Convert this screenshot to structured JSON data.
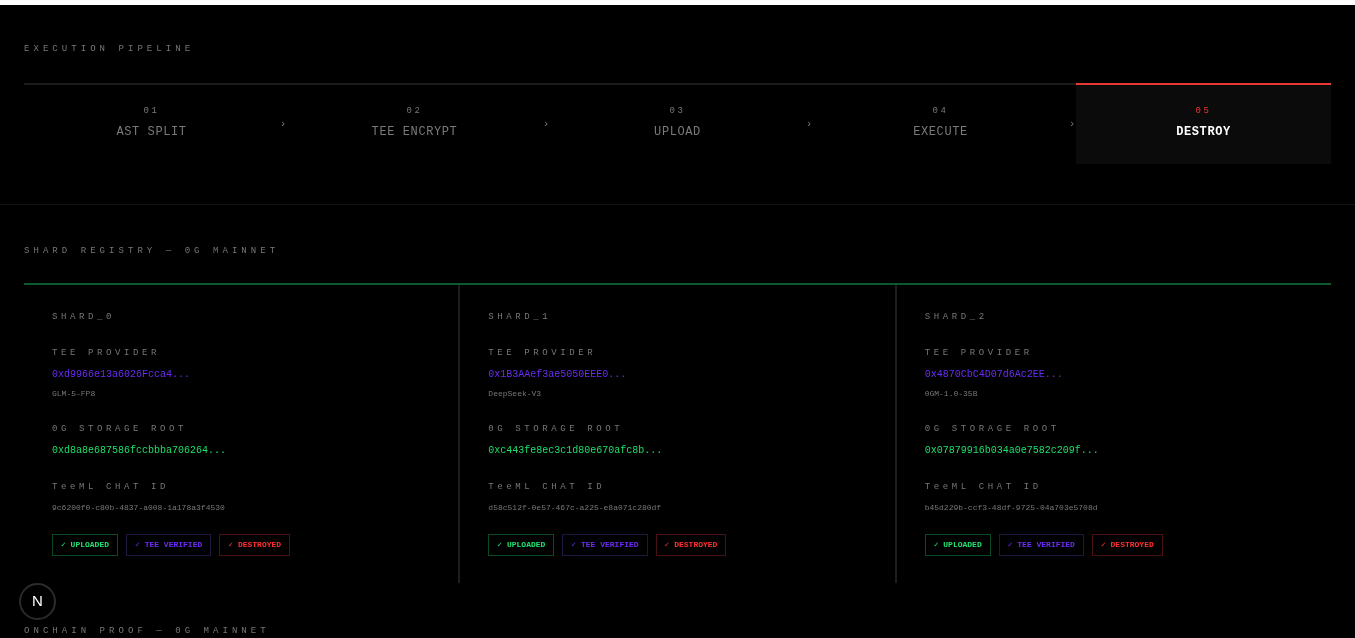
{
  "pipeline": {
    "title": "EXECUTION PIPELINE",
    "steps": [
      {
        "number": "01",
        "label": "AST SPLIT",
        "selected": false,
        "chevron": "›"
      },
      {
        "number": "02",
        "label": "TEE ENCRYPT",
        "selected": false,
        "chevron": "›"
      },
      {
        "number": "03",
        "label": "UPLOAD",
        "selected": false,
        "chevron": "›"
      },
      {
        "number": "04",
        "label": "EXECUTE",
        "selected": false,
        "chevron": "›"
      },
      {
        "number": "05",
        "label": "DESTROY",
        "selected": true
      }
    ]
  },
  "registry": {
    "title": "SHARD REGISTRY — 0G MAINNET",
    "shards": [
      {
        "name": "SHARD_0",
        "provider_label": "TEE PROVIDER",
        "provider": "0xd9966e13a6026Fcca4...",
        "model": "GLM-5-FP8",
        "storage_label": "0G STORAGE ROOT",
        "storage_root": "0xd8a8e687586fccbbba706264...",
        "chat_label": "TeeML CHAT ID",
        "chat_id": "9c6200f0-c80b-4837-a008-1a178a3f4530",
        "badges": [
          {
            "kind": "uploaded",
            "icon": "✓",
            "label": "UPLOADED"
          },
          {
            "kind": "verified",
            "icon": "✓",
            "label": "TEE VERIFIED"
          },
          {
            "kind": "destroyed",
            "icon": "✓",
            "label": "DESTROYED"
          }
        ]
      },
      {
        "name": "SHARD_1",
        "provider_label": "TEE PROVIDER",
        "provider": "0x1B3AAef3ae5050EEE0...",
        "model": "DeepSeek-V3",
        "storage_label": "0G STORAGE ROOT",
        "storage_root": "0xc443fe8ec3c1d80e670afc8b...",
        "chat_label": "TeeML CHAT ID",
        "chat_id": "d58c512f-0e57-467c-a225-e8a071c280df",
        "badges": [
          {
            "kind": "uploaded",
            "icon": "✓",
            "label": "UPLOADED"
          },
          {
            "kind": "verified",
            "icon": "✓",
            "label": "TEE VERIFIED"
          },
          {
            "kind": "destroyed",
            "icon": "✓",
            "label": "DESTROYED"
          }
        ]
      },
      {
        "name": "SHARD_2",
        "provider_label": "TEE PROVIDER",
        "provider": "0x4870CbC4D07d6Ac2EE...",
        "model": "0GM-1.0-35B",
        "storage_label": "0G STORAGE ROOT",
        "storage_root": "0x07879916b034a0e7582c209f...",
        "chat_label": "TeeML CHAT ID",
        "chat_id": "b45d229b-ccf3-48df-9725-04a703e5708d",
        "badges": [
          {
            "kind": "uploaded",
            "icon": "✓",
            "label": "UPLOADED"
          },
          {
            "kind": "verified",
            "icon": "✓",
            "label": "TEE VERIFIED"
          },
          {
            "kind": "destroyed",
            "icon": "✓",
            "label": "DESTROYED"
          }
        ]
      }
    ]
  },
  "proof": {
    "title": "ONCHAIN PROOF — 0G MAINNET"
  },
  "dev_indicator": {
    "letter": "N"
  }
}
